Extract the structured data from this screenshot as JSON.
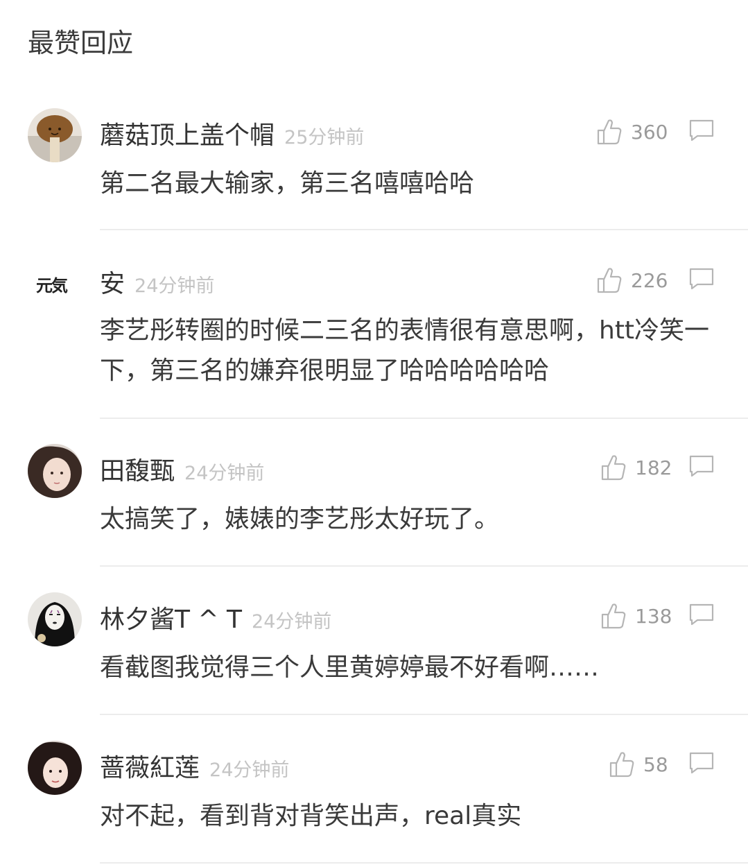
{
  "section_title": "最赞回应",
  "comments": [
    {
      "username": "蘑菇顶上盖个帽",
      "time": "25分钟前",
      "likes": "360",
      "content": "第二名最大输家，第三名嘻嘻哈哈",
      "avatar": "mushroom-avatar"
    },
    {
      "username": "安",
      "time": "24分钟前",
      "likes": "226",
      "content": "李艺彤转圈的时候二三名的表情很有意思啊，htt冷笑一下，第三名的嫌弃很明显了哈哈哈哈哈哈",
      "avatar_text": "元気"
    },
    {
      "username": "田馥甄",
      "time": "24分钟前",
      "likes": "182",
      "content": "太搞笑了，婊婊的李艺彤太好玩了。",
      "avatar": "girl-avatar"
    },
    {
      "username": "林夕酱T ^ T",
      "time": "24分钟前",
      "likes": "138",
      "content": "看截图我觉得三个人里黄婷婷最不好看啊……",
      "avatar": "noface-avatar"
    },
    {
      "username": "蔷薇紅莲",
      "time": "24分钟前",
      "likes": "58",
      "content": "对不起，看到背对背笑出声，real真实",
      "avatar": "woman-avatar"
    }
  ]
}
